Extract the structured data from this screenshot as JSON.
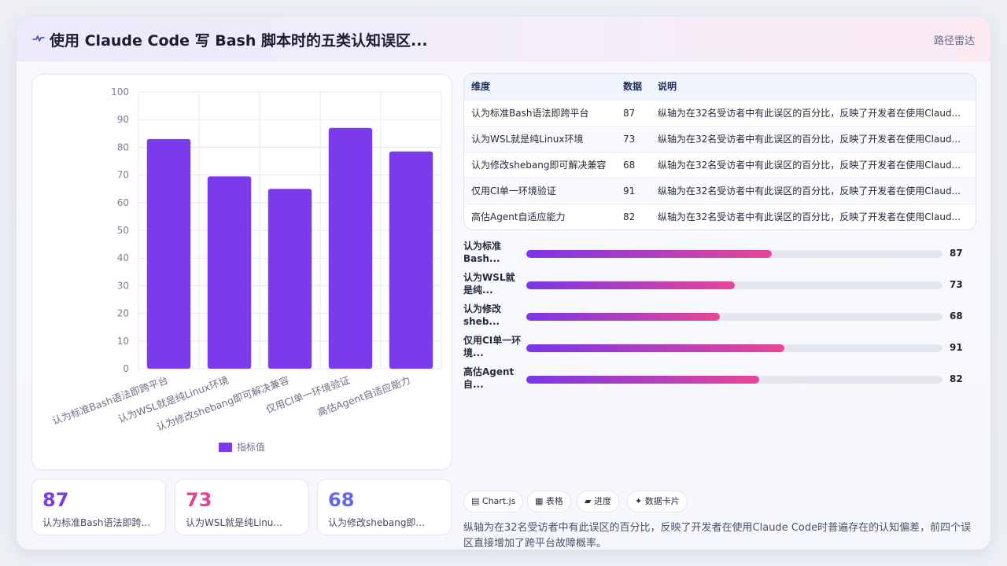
{
  "header": {
    "title": "使用 Claude Code 写 Bash 脚本时的五类认知误区...",
    "right_label": "路径雷达",
    "logo_icon": "pulse-icon"
  },
  "chart_data": {
    "type": "bar",
    "categories": [
      "认为标准Bash语法即跨平台",
      "认为WSL就是纯Linux环境",
      "认为修改shebang即可解决兼容",
      "仅用CI单一环境验证",
      "高估Agent自适应能力"
    ],
    "series": [
      {
        "name": "指标值",
        "values": [
          83,
          69.5,
          65,
          87,
          78.5
        ],
        "color": "#7c3aed"
      }
    ],
    "ylim": [
      0,
      100
    ],
    "yticks": [
      0,
      10,
      20,
      30,
      40,
      50,
      60,
      70,
      80,
      90,
      100
    ],
    "grid": true,
    "legend": "bottom"
  },
  "stats": [
    {
      "value": "87",
      "label": "认为标准Bash语法即跨...",
      "color": "#7c3aed"
    },
    {
      "value": "73",
      "label": "认为WSL就是纯Linu...",
      "color": "#e0458f"
    },
    {
      "value": "68",
      "label": "认为修改shebang即...",
      "color": "#6366f1"
    }
  ],
  "table": {
    "headers": [
      "维度",
      "数据",
      "说明"
    ],
    "rows": [
      {
        "dim": "认为标准Bash语法即跨平台",
        "value": "87",
        "desc": "纵轴为在32名受访者中有此误区的百分比，反映了开发者在使用Claud..."
      },
      {
        "dim": "认为WSL就是纯Linux环境",
        "value": "73",
        "desc": "纵轴为在32名受访者中有此误区的百分比，反映了开发者在使用Claud..."
      },
      {
        "dim": "认为修改shebang即可解决兼容",
        "value": "68",
        "desc": "纵轴为在32名受访者中有此误区的百分比，反映了开发者在使用Claud..."
      },
      {
        "dim": "仅用CI单一环境验证",
        "value": "91",
        "desc": "纵轴为在32名受访者中有此误区的百分比，反映了开发者在使用Claud..."
      },
      {
        "dim": "高估Agent自适应能力",
        "value": "82",
        "desc": "纵轴为在32名受访者中有此误区的百分比，反映了开发者在使用Claud..."
      }
    ]
  },
  "progress": [
    {
      "label_line1": "认为标准",
      "label_line2": "Bash...",
      "value": "87",
      "fill": 0.59
    },
    {
      "label_line1": "认为WSL就",
      "label_line2": "是纯...",
      "value": "73",
      "fill": 0.5
    },
    {
      "label_line1": "认为修改",
      "label_line2": "sheb...",
      "value": "68",
      "fill": 0.465
    },
    {
      "label_line1": "仅用CI单一环",
      "label_line2": "境...",
      "value": "91",
      "fill": 0.62
    },
    {
      "label_line1": "高估Agent",
      "label_line2": "自...",
      "value": "82",
      "fill": 0.56
    }
  ],
  "chips": [
    {
      "icon": "chart-icon",
      "glyph": "▤",
      "label": "Chart.js"
    },
    {
      "icon": "table-icon",
      "glyph": "▦",
      "label": "表格"
    },
    {
      "icon": "progress-icon",
      "glyph": "▰",
      "label": "进度"
    },
    {
      "icon": "sparkle-icon",
      "glyph": "✦",
      "label": "数据卡片"
    }
  ],
  "description": "纵轴为在32名受访者中有此误区的百分比，反映了开发者在使用Claude Code时普遍存在的认知偏差，前四个误区直接增加了跨平台故障概率。"
}
